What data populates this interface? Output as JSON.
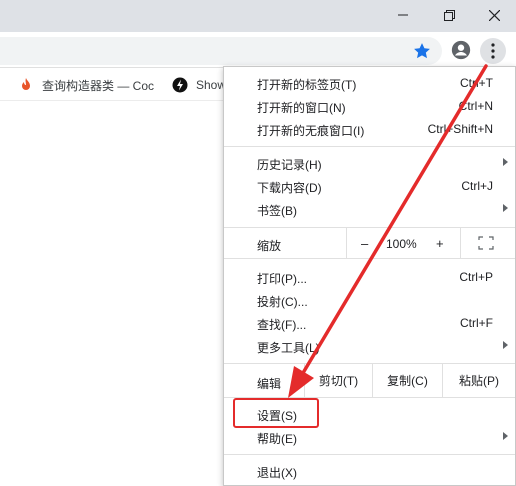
{
  "window": {
    "controls": {
      "minimize": "minimize-icon",
      "restore": "restore-icon",
      "close": "close-icon"
    }
  },
  "toolbar": {
    "star_icon": "bookmark-star-icon",
    "profile_icon": "profile-icon",
    "menu_icon": "kebab-menu-icon",
    "accent": "#1a73e8"
  },
  "bookmarks": [
    {
      "label": "查询构造器类 — Coc",
      "icon": "flame-icon"
    },
    {
      "label": "Show",
      "icon": "bolt-icon"
    }
  ],
  "menu": {
    "new_tab": {
      "label": "打开新的标签页(T)",
      "shortcut": "Ctrl+T"
    },
    "new_window": {
      "label": "打开新的窗口(N)",
      "shortcut": "Ctrl+N"
    },
    "incognito": {
      "label": "打开新的无痕窗口(I)",
      "shortcut": "Ctrl+Shift+N"
    },
    "history": {
      "label": "历史记录(H)"
    },
    "downloads": {
      "label": "下载内容(D)",
      "shortcut": "Ctrl+J"
    },
    "bookmarks": {
      "label": "书签(B)"
    },
    "zoom": {
      "label": "缩放",
      "minus": "–",
      "value": "100%",
      "plus": "+"
    },
    "print": {
      "label": "打印(P)...",
      "shortcut": "Ctrl+P"
    },
    "cast": {
      "label": "投射(C)..."
    },
    "find": {
      "label": "查找(F)...",
      "shortcut": "Ctrl+F"
    },
    "more_tools": {
      "label": "更多工具(L)"
    },
    "edit": {
      "label": "编辑",
      "cut": "剪切(T)",
      "copy": "复制(C)",
      "paste": "粘贴(P)"
    },
    "settings": {
      "label": "设置(S)"
    },
    "help": {
      "label": "帮助(E)"
    },
    "exit": {
      "label": "退出(X)"
    }
  },
  "annotation": {
    "color": "#e42b2b"
  }
}
